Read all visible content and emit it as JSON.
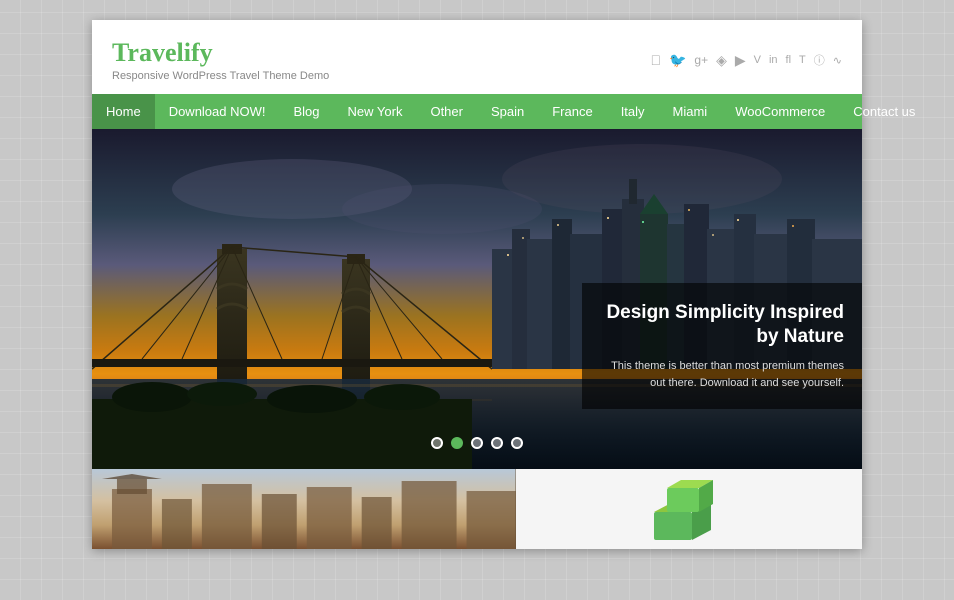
{
  "site": {
    "title": "Travelify",
    "tagline": "Responsive WordPress Travel Theme Demo"
  },
  "social": {
    "icons": [
      "f",
      "t",
      "g+",
      "p",
      "▶",
      "v",
      "in",
      "fl",
      "T",
      "📷",
      "RSS"
    ]
  },
  "nav": {
    "items": [
      {
        "label": "Home",
        "active": true
      },
      {
        "label": "Download NOW!",
        "active": false
      },
      {
        "label": "Blog",
        "active": false
      },
      {
        "label": "New York",
        "active": false
      },
      {
        "label": "Other",
        "active": false
      },
      {
        "label": "Spain",
        "active": false
      },
      {
        "label": "France",
        "active": false
      },
      {
        "label": "Italy",
        "active": false
      },
      {
        "label": "Miami",
        "active": false
      },
      {
        "label": "WooCommerce",
        "active": false
      },
      {
        "label": "Contact us",
        "active": false
      }
    ]
  },
  "slider": {
    "caption_title": "Design Simplicity Inspired by Nature",
    "caption_text": "This theme is better than most premium themes out there. Download it and see yourself.",
    "dots": [
      {
        "active": false
      },
      {
        "active": true
      },
      {
        "active": false
      },
      {
        "active": false
      },
      {
        "active": false
      }
    ]
  },
  "colors": {
    "green": "#5cb85c",
    "nav_bg": "#5cb85c"
  }
}
